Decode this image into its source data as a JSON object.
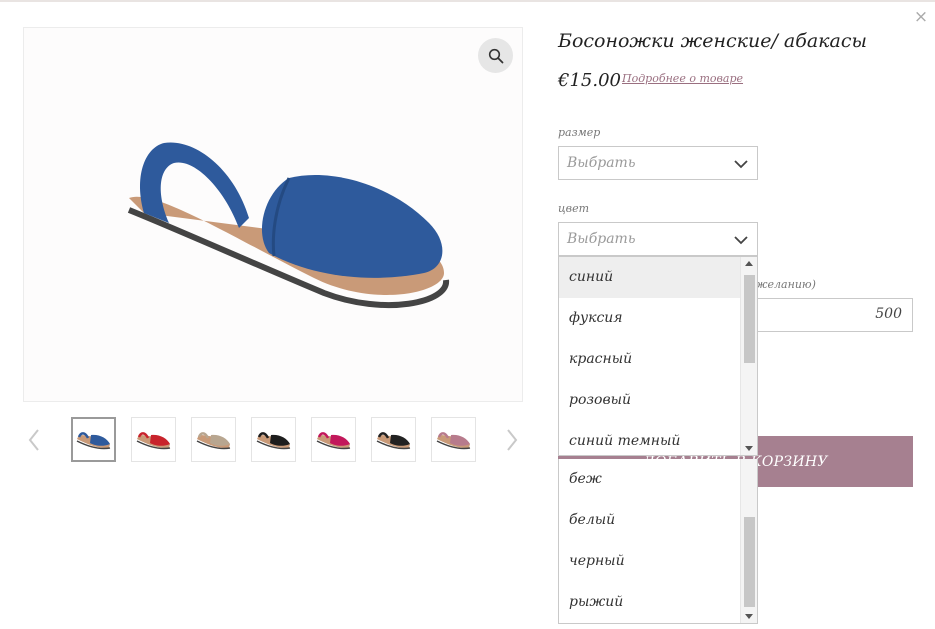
{
  "product": {
    "title": "Босоножки женские/ абакасы",
    "price": "€15.00",
    "more_link": "Подробнее о товаре"
  },
  "close_label": "×",
  "size": {
    "label": "размер",
    "placeholder": "Выбрать"
  },
  "color": {
    "label": "цвет",
    "placeholder": "Выбрать"
  },
  "quantity": {
    "label": "желанию)",
    "value": "500"
  },
  "cart_button": "ДОБАВИТЬ В КОРЗИНУ",
  "color_options_upper": [
    "синий",
    "фуксия",
    "красный",
    "розовый",
    "синий темный"
  ],
  "color_options_lower": [
    "беж",
    "белый",
    "черный",
    "рыжий"
  ],
  "highlighted_option": "синий",
  "thumbnails": [
    {
      "name": "blue",
      "color": "#2e5a9c"
    },
    {
      "name": "red",
      "color": "#c8232c"
    },
    {
      "name": "beige",
      "color": "#b8a690"
    },
    {
      "name": "black",
      "color": "#1d1d1d"
    },
    {
      "name": "fuchsia",
      "color": "#c2185b"
    },
    {
      "name": "black",
      "color": "#222222"
    },
    {
      "name": "pink",
      "color": "#b77b8c"
    }
  ],
  "colors": {
    "accent": "#a68090",
    "link": "#9a6f80",
    "main_sandal": "#2e5a9c",
    "sole": "#c99a78"
  }
}
